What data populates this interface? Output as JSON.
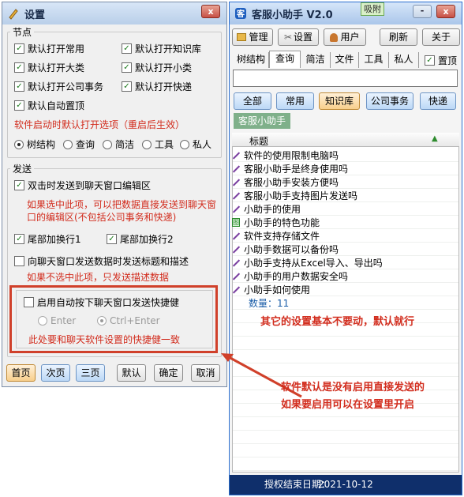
{
  "settings": {
    "title": "设置",
    "close_label": "x",
    "nodes_legend": "节点",
    "nodes": [
      {
        "label": "默认打开常用",
        "checked": true
      },
      {
        "label": "默认打开知识库",
        "checked": true
      },
      {
        "label": "默认打开大类",
        "checked": true
      },
      {
        "label": "默认打开小类",
        "checked": true
      },
      {
        "label": "默认打开公司事务",
        "checked": true
      },
      {
        "label": "默认打开快递",
        "checked": true
      },
      {
        "label": "默认自动置顶",
        "checked": true
      }
    ],
    "startup_note": "软件启动时默认打开选项（重启后生效）",
    "startup_options": [
      {
        "label": "树结构",
        "selected": true
      },
      {
        "label": "查询",
        "selected": false
      },
      {
        "label": "简洁",
        "selected": false
      },
      {
        "label": "工具",
        "selected": false
      },
      {
        "label": "私人",
        "selected": false
      }
    ],
    "send_legend": "发送",
    "double_click_label": "双击时发送到聊天窗口编辑区",
    "double_click_note": "如果选中此项，可以把数据直接发送到聊天窗口的编辑区(不包括公司事务和快递)",
    "tail1_label": "尾部加换行1",
    "tail2_label": "尾部加换行2",
    "title_desc_label": "向聊天窗口发送数据时发送标题和描述",
    "title_desc_note": "如果不选中此项，只发送描述数据",
    "auto_key_label": "启用自动按下聊天窗口发送快捷健",
    "enter_label": "Enter",
    "ctrl_enter_label": "Ctrl+Enter",
    "hotkey_note": "此处要和聊天软件设置的快捷健一致",
    "buttons": {
      "first": "首页",
      "second": "次页",
      "third": "三页",
      "default": "默认",
      "ok": "确定",
      "cancel": "取消"
    }
  },
  "assistant": {
    "title": "客服小助手 V2.0",
    "badge": "吸附",
    "minimize_label": "-",
    "close_label": "x",
    "toolbar": {
      "manage": "管理",
      "settings": "设置",
      "user": "用户",
      "refresh": "刷新",
      "about": "关于"
    },
    "tabs": [
      "树结构",
      "查询",
      "简洁",
      "文件",
      "工具",
      "私人"
    ],
    "pin_label": "置顶",
    "search_value": "",
    "categories": [
      "全部",
      "常用",
      "知识库",
      "公司事务",
      "快递"
    ],
    "active_category": "知识库",
    "group_label": "客服小助手",
    "column_title": "标题",
    "sort_indicator": "▲",
    "items": [
      {
        "icon": "pen",
        "text": "软件的使用限制电脑吗"
      },
      {
        "icon": "pen",
        "text": "客服小助手是终身使用吗"
      },
      {
        "icon": "pen",
        "text": "客服小助手安装方便吗"
      },
      {
        "icon": "pen",
        "text": "客服小助手支持图片发送吗"
      },
      {
        "icon": "pen",
        "text": "小助手的使用"
      },
      {
        "icon": "image",
        "text": "小助手的特色功能"
      },
      {
        "icon": "pen",
        "text": "软件支持存储文件"
      },
      {
        "icon": "pen",
        "text": "小助手数据可以备份吗"
      },
      {
        "icon": "pen",
        "text": "小助手支持从Excel导入、导出吗"
      },
      {
        "icon": "pen",
        "text": "小助手的用户数据安全吗"
      },
      {
        "icon": "pen",
        "text": "小助手如何使用"
      }
    ],
    "count_label": "数量：11",
    "license_label": "授权结束日期：",
    "license_date": "2021-10-12"
  },
  "annotations": {
    "note1": "其它的设置基本不要动，默认就行",
    "note2_line1": "软件默认是没有启用直接发送的",
    "note2_line2": "如果要启用可以在设置里开启"
  },
  "colors": {
    "annotation_red": "#d22d1e",
    "title_blue": "#1a2c4a",
    "status_blue": "#0f2f6b"
  }
}
